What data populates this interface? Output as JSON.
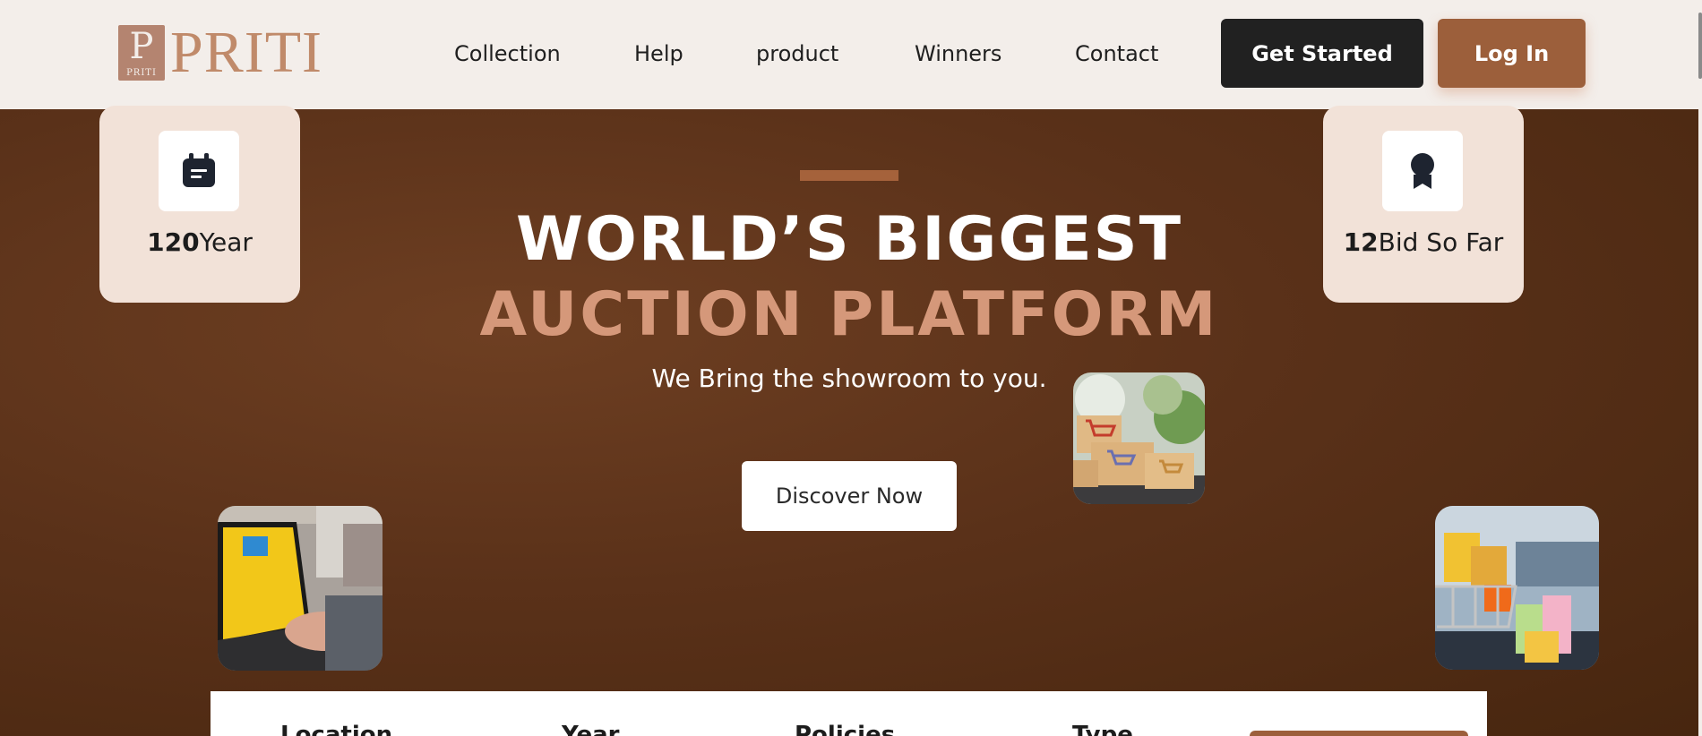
{
  "brand": {
    "mark_letter": "P",
    "mark_small": "PRITI",
    "name": "PRITI"
  },
  "nav": {
    "items": [
      {
        "label": "Collection"
      },
      {
        "label": "Help"
      },
      {
        "label": "product"
      },
      {
        "label": "Winners"
      },
      {
        "label": "Contact"
      }
    ]
  },
  "header": {
    "get_started_label": "Get Started",
    "login_label": "Log In"
  },
  "stats": [
    {
      "value": "120",
      "label": "Year",
      "icon": "calendar-icon"
    },
    {
      "value": "12",
      "label": "Bid So Far",
      "icon": "award-icon"
    }
  ],
  "hero": {
    "title_line1": "WORLD’S BIGGEST",
    "title_line2": "AUCTION PLATFORM",
    "tagline": "We Bring the showroom to you.",
    "cta_label": "Discover Now"
  },
  "photos": [
    {
      "name": "shopping-carts-boxes-image"
    },
    {
      "name": "online-shopping-laptop-image"
    },
    {
      "name": "cart-shopping-bags-image"
    }
  ],
  "filters": {
    "labels": [
      "Location",
      "Year",
      "Policies",
      "Type"
    ]
  },
  "colors": {
    "accent": "#9c5f3b",
    "dark_button": "#212121",
    "hero_brown": "#5a3119",
    "title_accent": "#d5987a",
    "card_bg": "#f2e2d8",
    "page_bg": "#f3eeea"
  }
}
